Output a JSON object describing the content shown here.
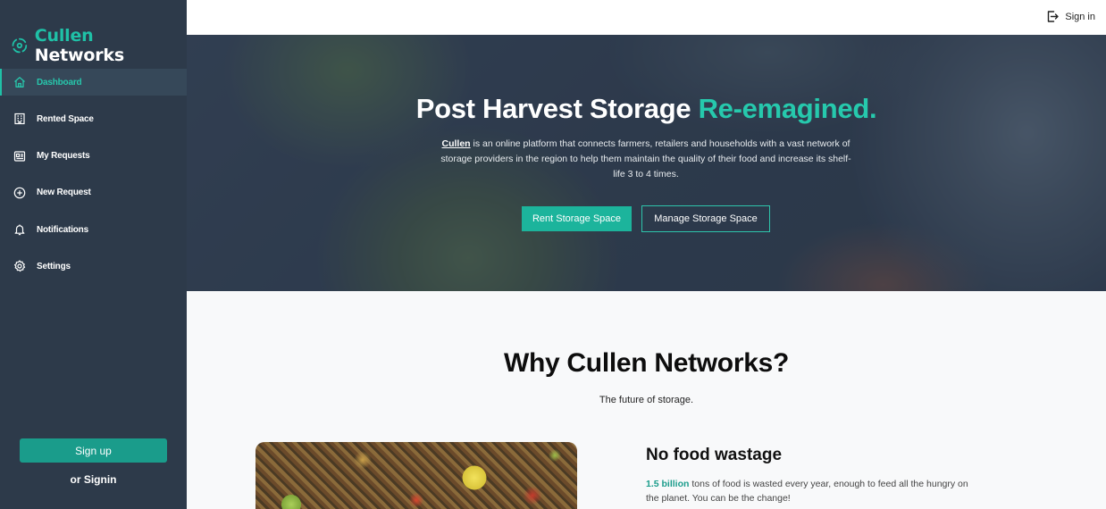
{
  "brand": {
    "accent": "Cullen",
    "rest": "Networks",
    "icon": "logo-icon"
  },
  "sidebar": {
    "items": [
      {
        "label": "Dashboard",
        "icon": "home-icon",
        "active": true
      },
      {
        "label": "Rented Space",
        "icon": "building-icon"
      },
      {
        "label": "My Requests",
        "icon": "requests-icon"
      },
      {
        "label": "New Request",
        "icon": "plus-circle-icon"
      },
      {
        "label": "Notifications",
        "icon": "bell-icon"
      },
      {
        "label": "Settings",
        "icon": "gear-icon"
      }
    ],
    "signup_label": "Sign up",
    "or_signin_label": "or Signin"
  },
  "topbar": {
    "signin_label": "Sign in",
    "signin_icon": "sign-in-icon"
  },
  "hero": {
    "title_main": "Post Harvest Storage ",
    "title_accent": "Re-emagined.",
    "desc_brand": "Cullen",
    "desc_text": " is an online platform that connects farmers, retailers and households with a vast network of storage providers in the region to help them maintain the quality of their food and increase its shelf-life 3 to 4 times.",
    "rent_label": "Rent Storage Space",
    "manage_label": "Manage Storage Space"
  },
  "why": {
    "title": "Why Cullen Networks?",
    "subtitle": "The future of storage."
  },
  "feature": {
    "title": "No food wastage",
    "stat": "1.5 billion",
    "desc": " tons of food is wasted every year, enough to feed all the hungry on the planet. You can be the change!"
  },
  "colors": {
    "sidebar_bg": "#2d3a4a",
    "accent": "#1fc1a7",
    "button": "#1a9c8b"
  }
}
